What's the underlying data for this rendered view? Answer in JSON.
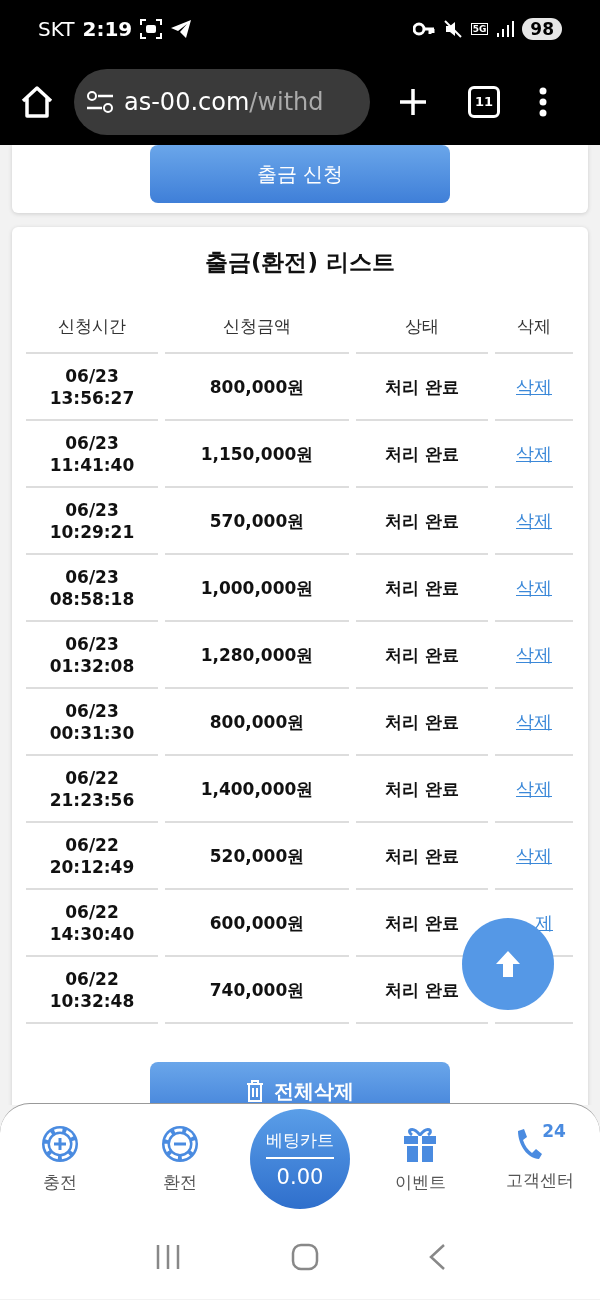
{
  "status_bar": {
    "carrier": "SKT",
    "time": "2:19",
    "network": "5G",
    "battery": "98"
  },
  "browser": {
    "url_host": "as-00.com",
    "url_path": "/withd",
    "tab_count": "11"
  },
  "apply_button": "출금 신청",
  "list": {
    "title": "출금(환전) 리스트",
    "columns": [
      "신청시간",
      "신청금액",
      "상태",
      "삭제"
    ],
    "rows": [
      {
        "date": "06/23",
        "time": "13:56:27",
        "amount": "800,000원",
        "status": "처리 완료",
        "action": "삭제"
      },
      {
        "date": "06/23",
        "time": "11:41:40",
        "amount": "1,150,000원",
        "status": "처리 완료",
        "action": "삭제"
      },
      {
        "date": "06/23",
        "time": "10:29:21",
        "amount": "570,000원",
        "status": "처리 완료",
        "action": "삭제"
      },
      {
        "date": "06/23",
        "time": "08:58:18",
        "amount": "1,000,000원",
        "status": "처리 완료",
        "action": "삭제"
      },
      {
        "date": "06/23",
        "time": "01:32:08",
        "amount": "1,280,000원",
        "status": "처리 완료",
        "action": "삭제"
      },
      {
        "date": "06/23",
        "time": "00:31:30",
        "amount": "800,000원",
        "status": "처리 완료",
        "action": "삭제"
      },
      {
        "date": "06/22",
        "time": "21:23:56",
        "amount": "1,400,000원",
        "status": "처리 완료",
        "action": "삭제"
      },
      {
        "date": "06/22",
        "time": "20:12:49",
        "amount": "520,000원",
        "status": "처리 완료",
        "action": "삭제"
      },
      {
        "date": "06/22",
        "time": "14:30:40",
        "amount": "600,000원",
        "status": "처리 완료",
        "action": "제",
        "covered": true
      },
      {
        "date": "06/22",
        "time": "10:32:48",
        "amount": "740,000원",
        "status": "처리 완료"
      }
    ],
    "delete_all_button": "전체삭제"
  },
  "bottom_nav": {
    "items": [
      {
        "kind": "deposit",
        "label": "충전"
      },
      {
        "kind": "withdraw",
        "label": "환전"
      },
      {
        "kind": "cart",
        "label": "베팅카트",
        "value": "0.00"
      },
      {
        "kind": "event",
        "label": "이벤트"
      },
      {
        "kind": "support",
        "label": "고객센터",
        "badge": "24"
      }
    ]
  }
}
